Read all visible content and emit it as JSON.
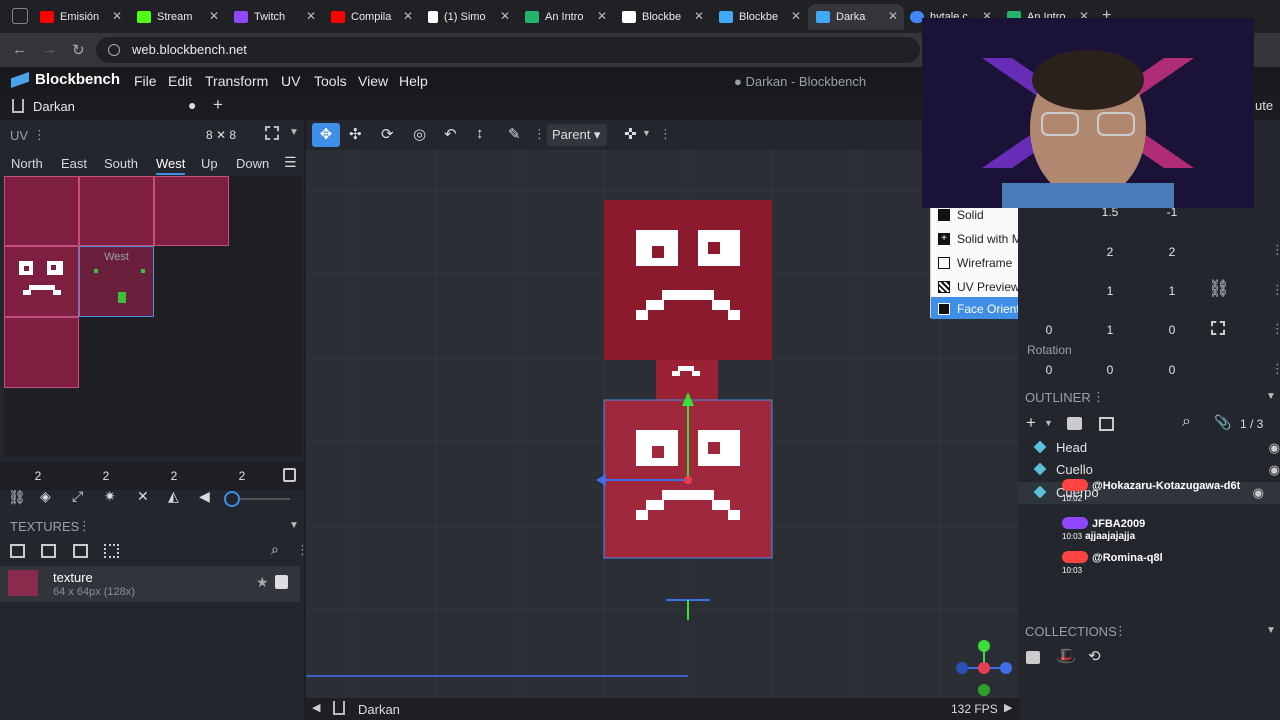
{
  "browser": {
    "tabs": [
      {
        "label": "Emisión",
        "color": "#ff0000"
      },
      {
        "label": "Stream",
        "color": "#53fc18"
      },
      {
        "label": "Twitch",
        "color": "#9146ff"
      },
      {
        "label": "Compila",
        "color": "#ff0000"
      },
      {
        "label": "(1) Simo",
        "color": "#ffffff"
      },
      {
        "label": "An Intro",
        "color": "#24b36b"
      },
      {
        "label": "Blockbe",
        "color": "#ffffff"
      },
      {
        "label": "Blockbe",
        "color": "#3fa9f5"
      },
      {
        "label": "Darka",
        "color": "#3fa9f5"
      },
      {
        "label": "hytale c",
        "color": "#4285f4"
      },
      {
        "label": "An Intro",
        "color": "#24b36b"
      }
    ],
    "new_tab": "+",
    "url": "web.blockbench.net"
  },
  "app": {
    "name": "Blockbench",
    "menu": [
      "File",
      "Edit",
      "Transform",
      "UV",
      "Tools",
      "View",
      "Help"
    ],
    "window_title": "● Darkan - Blockbench",
    "project_tab": "Darkan",
    "project_dot": "●",
    "add_tab": "+",
    "right_cut_label": "ute"
  },
  "uv_panel": {
    "title": "UV",
    "size": "8 ✕ 8",
    "faces": [
      "North",
      "East",
      "South",
      "West",
      "Up",
      "Down"
    ],
    "active_face": "West",
    "face_label": "West",
    "values": [
      "2",
      "2",
      "2",
      "2"
    ]
  },
  "textures": {
    "title": "TEXTURES",
    "name": "texture",
    "info": "64 x 64px (128x)"
  },
  "toolbar": {
    "mode": "Parent"
  },
  "view_menu": {
    "items": [
      "Solid",
      "Solid with Marker Colors",
      "Wireframe",
      "UV Preview",
      "Face Orientation"
    ],
    "selected": "Face Orientation"
  },
  "element_props": {
    "row0": [
      "1.5",
      "-1"
    ],
    "row1": [
      "2",
      "2"
    ],
    "row2": [
      "1",
      "1"
    ],
    "row3": [
      "0",
      "1",
      "0"
    ],
    "rotation_label": "Rotation",
    "rotation": [
      "0",
      "0",
      "0"
    ]
  },
  "outliner": {
    "title": "OUTLINER",
    "count": "1 / 3",
    "items": [
      "Head",
      "Cuello",
      "Cuerpo"
    ]
  },
  "chat": [
    {
      "user": "@Hokazaru-Kotazugawa-d6t",
      "time": "10:02",
      "msg": ""
    },
    {
      "user": "JFBA2009",
      "time": "10:03",
      "msg": "ajjaajajajja"
    },
    {
      "user": "@Romina-q8l",
      "time": "10:03",
      "msg": ""
    }
  ],
  "collections": {
    "title": "COLLECTIONS"
  },
  "status": {
    "project": "Darkan",
    "fps": "132 FPS"
  }
}
